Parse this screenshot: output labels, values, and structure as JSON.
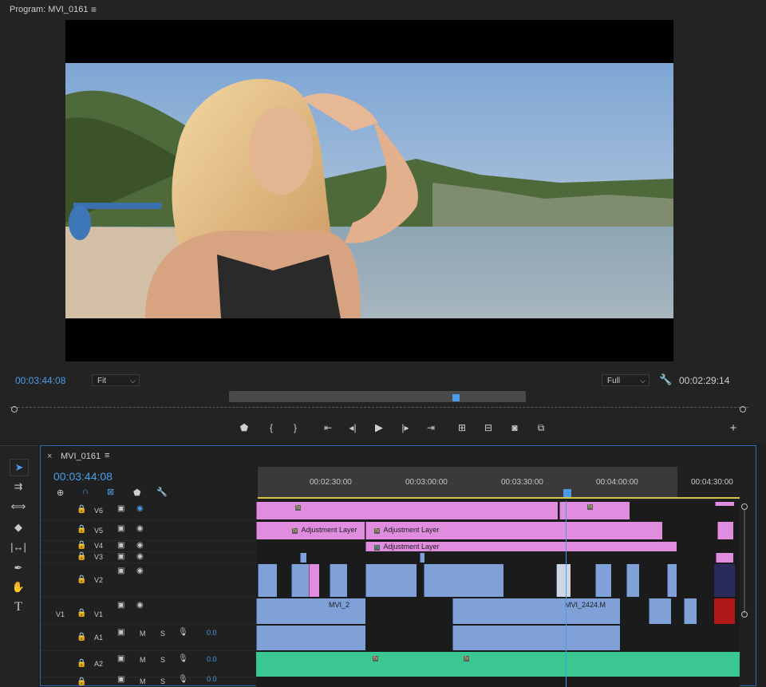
{
  "monitor": {
    "title": "Program: MVI_0161",
    "menu_icon": "hamburger-icon",
    "timecode_current": "00:03:44:08",
    "fit": "Fit",
    "quality": "Full",
    "timecode_duration": "00:02:29:14"
  },
  "controls": {
    "marker": "marker-icon",
    "in": "{",
    "out": "}",
    "go_in": "go-to-in-icon",
    "step_back": "step-back-icon",
    "play": "play-icon",
    "step_fwd": "step-forward-icon",
    "go_out": "go-to-out-icon",
    "lift": "lift-icon",
    "extract": "extract-icon",
    "export_frame": "camera-icon",
    "compare": "compare-icon",
    "add": "+"
  },
  "timeline": {
    "close": "×",
    "sequence_name": "MVI_0161",
    "timecode": "00:03:44:08",
    "ruler": [
      "00:02:30:00",
      "00:03:00:00",
      "00:03:30:00",
      "00:04:00:00",
      "00:04:30:00"
    ],
    "tracks": {
      "v6": "V6",
      "v5": "V5",
      "v4": "V4",
      "v3": "V3",
      "v2": "V2",
      "v1_src": "V1",
      "v1": "V1",
      "a1": "A1",
      "a2": "A2",
      "m": "M",
      "s": "S",
      "vol1": "0.0",
      "vol2": "0.0",
      "vol3": "0.0"
    },
    "clips": {
      "adj1": "Adjustment Layer",
      "adj2": "Adjustment Layer",
      "adj3": "Adjustment Layer",
      "v1_a": "MVI_2",
      "v1_b": "MVI_2424.M",
      "fx": "fx"
    }
  },
  "colors": {
    "accent": "#4a9be8",
    "adjustment": "#e08de0",
    "video_clip": "#7fa1d8",
    "audio_clip": "#3bc792"
  }
}
